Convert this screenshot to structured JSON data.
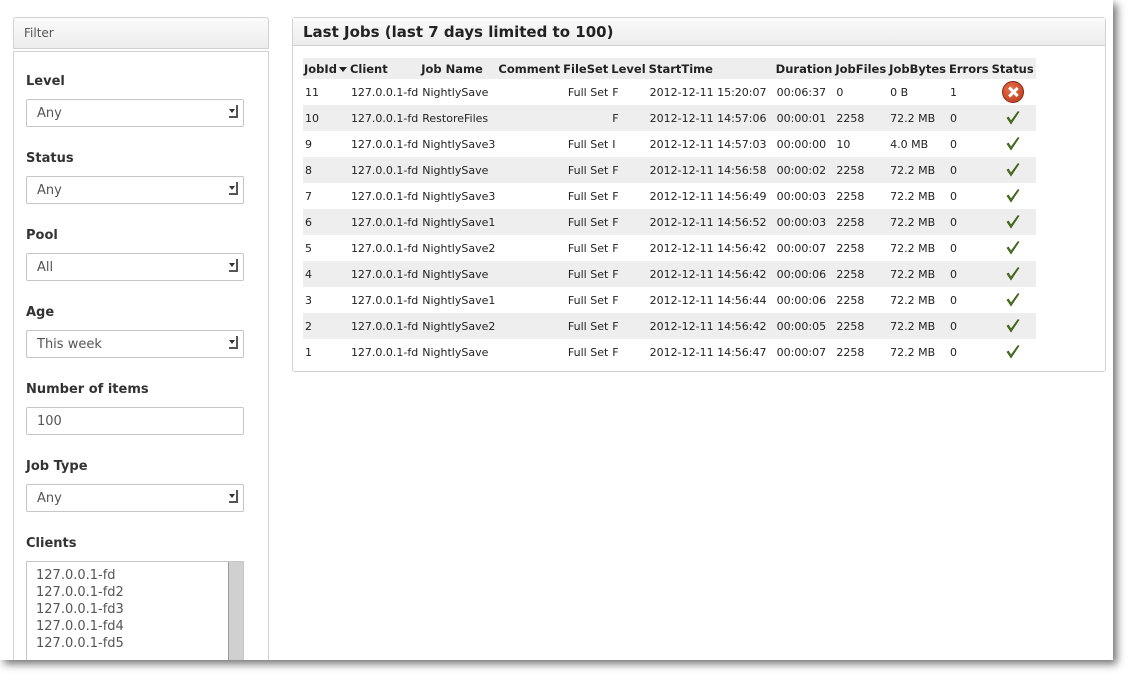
{
  "sidebar": {
    "filter_label": "Filter",
    "level": {
      "label": "Level",
      "value": "Any"
    },
    "status": {
      "label": "Status",
      "value": "Any"
    },
    "pool": {
      "label": "Pool",
      "value": "All"
    },
    "age": {
      "label": "Age",
      "value": "This week"
    },
    "items": {
      "label": "Number of items",
      "value": "100"
    },
    "jobtype": {
      "label": "Job Type",
      "value": "Any"
    },
    "clients": {
      "label": "Clients",
      "options": [
        "127.0.0.1-fd",
        "127.0.0.1-fd2",
        "127.0.0.1-fd3",
        "127.0.0.1-fd4",
        "127.0.0.1-fd5"
      ]
    }
  },
  "panel": {
    "title": "Last Jobs (last 7 days limited to 100)"
  },
  "table": {
    "headers": [
      "JobId",
      "Client",
      "Job Name",
      "Comment",
      "FileSet",
      "Level",
      "StartTime",
      "Duration",
      "JobFiles",
      "JobBytes",
      "Errors",
      "Status"
    ],
    "rows": [
      {
        "jobid": "11",
        "client": "127.0.0.1-fd",
        "name": "NightlySave",
        "comment": "",
        "fileset": "Full Set",
        "level": "F",
        "start": "2012-12-11 15:20:07",
        "duration": "00:06:37",
        "files": "0",
        "bytes": "0 B",
        "errors": "1",
        "status": "error"
      },
      {
        "jobid": "10",
        "client": "127.0.0.1-fd",
        "name": "RestoreFiles",
        "comment": "",
        "fileset": "",
        "level": "F",
        "start": "2012-12-11 14:57:06",
        "duration": "00:00:01",
        "files": "2258",
        "bytes": "72.2 MB",
        "errors": "0",
        "status": "ok"
      },
      {
        "jobid": "9",
        "client": "127.0.0.1-fd",
        "name": "NightlySave3",
        "comment": "",
        "fileset": "Full Set",
        "level": "I",
        "start": "2012-12-11 14:57:03",
        "duration": "00:00:00",
        "files": "10",
        "bytes": "4.0 MB",
        "errors": "0",
        "status": "ok"
      },
      {
        "jobid": "8",
        "client": "127.0.0.1-fd",
        "name": "NightlySave",
        "comment": "",
        "fileset": "Full Set",
        "level": "F",
        "start": "2012-12-11 14:56:58",
        "duration": "00:00:02",
        "files": "2258",
        "bytes": "72.2 MB",
        "errors": "0",
        "status": "ok"
      },
      {
        "jobid": "7",
        "client": "127.0.0.1-fd",
        "name": "NightlySave3",
        "comment": "",
        "fileset": "Full Set",
        "level": "F",
        "start": "2012-12-11 14:56:49",
        "duration": "00:00:03",
        "files": "2258",
        "bytes": "72.2 MB",
        "errors": "0",
        "status": "ok"
      },
      {
        "jobid": "6",
        "client": "127.0.0.1-fd",
        "name": "NightlySave1",
        "comment": "",
        "fileset": "Full Set",
        "level": "F",
        "start": "2012-12-11 14:56:52",
        "duration": "00:00:03",
        "files": "2258",
        "bytes": "72.2 MB",
        "errors": "0",
        "status": "ok"
      },
      {
        "jobid": "5",
        "client": "127.0.0.1-fd",
        "name": "NightlySave2",
        "comment": "",
        "fileset": "Full Set",
        "level": "F",
        "start": "2012-12-11 14:56:42",
        "duration": "00:00:07",
        "files": "2258",
        "bytes": "72.2 MB",
        "errors": "0",
        "status": "ok"
      },
      {
        "jobid": "4",
        "client": "127.0.0.1-fd",
        "name": "NightlySave",
        "comment": "",
        "fileset": "Full Set",
        "level": "F",
        "start": "2012-12-11 14:56:42",
        "duration": "00:00:06",
        "files": "2258",
        "bytes": "72.2 MB",
        "errors": "0",
        "status": "ok"
      },
      {
        "jobid": "3",
        "client": "127.0.0.1-fd",
        "name": "NightlySave1",
        "comment": "",
        "fileset": "Full Set",
        "level": "F",
        "start": "2012-12-11 14:56:44",
        "duration": "00:00:06",
        "files": "2258",
        "bytes": "72.2 MB",
        "errors": "0",
        "status": "ok"
      },
      {
        "jobid": "2",
        "client": "127.0.0.1-fd",
        "name": "NightlySave2",
        "comment": "",
        "fileset": "Full Set",
        "level": "F",
        "start": "2012-12-11 14:56:42",
        "duration": "00:00:05",
        "files": "2258",
        "bytes": "72.2 MB",
        "errors": "0",
        "status": "ok"
      },
      {
        "jobid": "1",
        "client": "127.0.0.1-fd",
        "name": "NightlySave",
        "comment": "",
        "fileset": "Full Set",
        "level": "F",
        "start": "2012-12-11 14:56:47",
        "duration": "00:00:07",
        "files": "2258",
        "bytes": "72.2 MB",
        "errors": "0",
        "status": "ok"
      }
    ]
  },
  "colors": {
    "ok": "#4a7a1e",
    "error": "#c0401f",
    "row_alt": "#eeeeee",
    "border": "#d2d2d2"
  }
}
